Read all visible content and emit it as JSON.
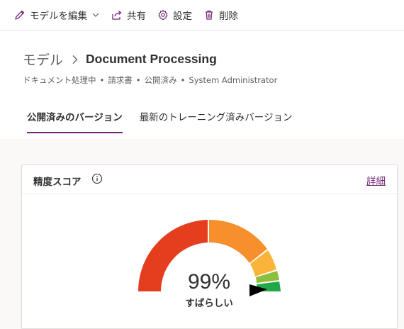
{
  "toolbar": {
    "edit_label": "モデルを編集",
    "share_label": "共有",
    "settings_label": "設定",
    "delete_label": "削除"
  },
  "breadcrumb": {
    "root": "モデル",
    "current": "Document Processing"
  },
  "meta": {
    "status": "ドキュメント処理中",
    "doc_type": "請求書",
    "publish_state": "公開済み",
    "owner": "System Administrator"
  },
  "tabs": [
    {
      "label": "公開済みのバージョン",
      "active": true
    },
    {
      "label": "最新のトレーニング済みバージョン",
      "active": false
    }
  ],
  "accuracy_card": {
    "title": "精度スコア",
    "detail_link": "詳細",
    "score_text": "99%",
    "score_value": 0.99,
    "rating": "すばらしい"
  },
  "colors": {
    "accent": "#742774",
    "gauge_red": "#e43e1f",
    "gauge_orange": "#f7902c",
    "gauge_yellow": "#fbb43a",
    "gauge_lightgreen": "#8dbe3d",
    "gauge_green": "#22a84a"
  },
  "icons": {
    "edit": "pencil-icon",
    "share": "share-icon",
    "settings": "gear-icon",
    "delete": "trash-icon",
    "info": "info-icon",
    "pointer": "triangle-pointer-icon"
  }
}
